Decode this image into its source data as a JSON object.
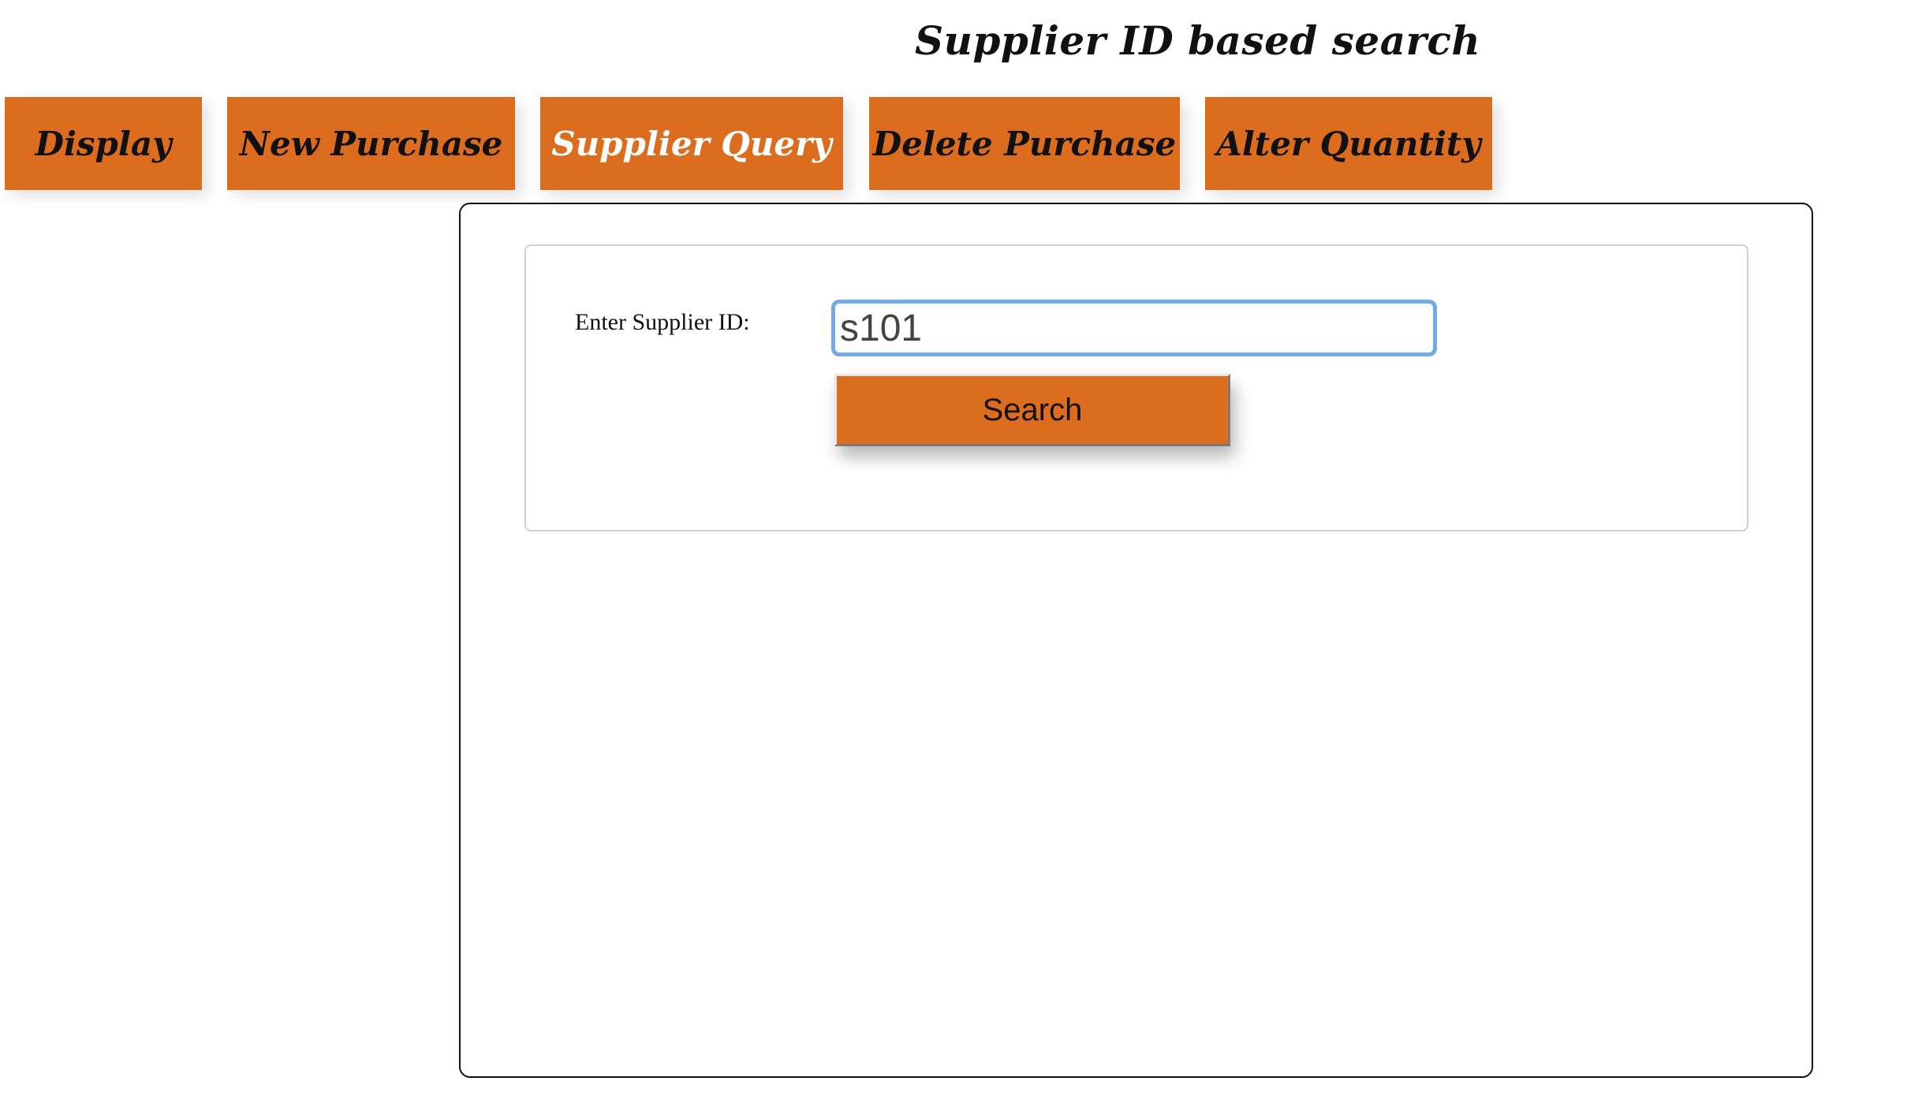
{
  "header": {
    "title": "Supplier ID based search"
  },
  "nav": {
    "tabs": [
      {
        "label": "Display"
      },
      {
        "label": "New Purchase"
      },
      {
        "label": "Supplier Query"
      },
      {
        "label": "Delete Purchase"
      },
      {
        "label": "Alter Quantity"
      }
    ],
    "active_tab": "Supplier Query"
  },
  "form": {
    "label": "Enter Supplier ID:",
    "supplier_id_value": "s101",
    "search_label": "Search"
  },
  "colors": {
    "accent": "#dc6d1f",
    "active_tab_text": "#ffffff",
    "input_focus_border": "#74a9e8"
  }
}
